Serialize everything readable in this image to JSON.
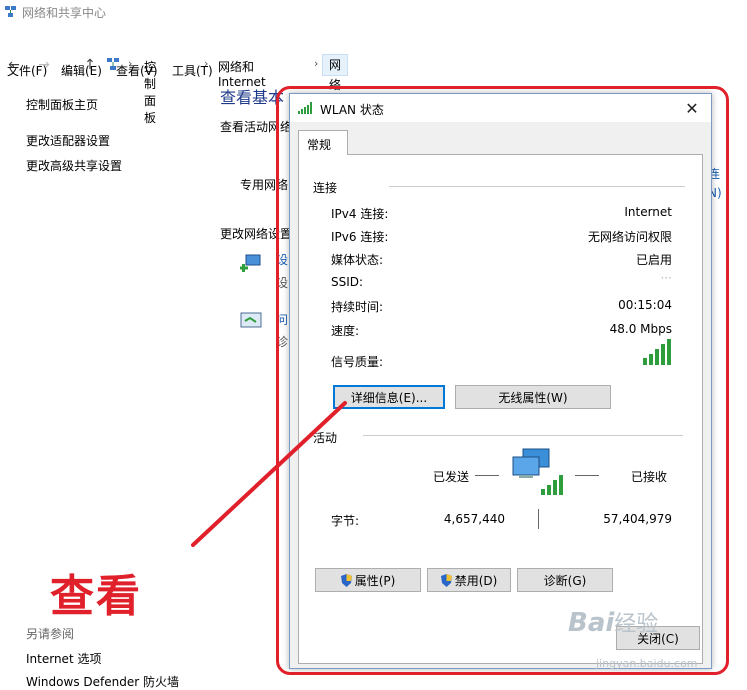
{
  "window": {
    "title": "网络和共享中心"
  },
  "breadcrumb": {
    "items": [
      "控制面板",
      "网络和 Internet",
      "网络和共享中心"
    ]
  },
  "menu": {
    "items": [
      "文件(F)",
      "编辑(E)",
      "查看(V)",
      "工具(T)"
    ]
  },
  "sidebar": {
    "home": "控制面板主页",
    "adapter": "更改适配器设置",
    "advanced": "更改高级共享设置",
    "see_also": "另请参阅",
    "internet_options": "Internet 选项",
    "defender": "Windows Defender 防火墙"
  },
  "main": {
    "heading_partial": "查看基本",
    "active_partial": "查看活动网络",
    "private_partial": "专用网络",
    "change_partial": "更改网络设置",
    "item1_partial": "设",
    "item1_sub": "设",
    "item2_partial": "问",
    "item2_sub": "诊",
    "right_partial1": "连",
    "right_partial2": "N)"
  },
  "dialog": {
    "title": "WLAN 状态",
    "tab": "常规",
    "connection_group": "连接",
    "rows": [
      {
        "label": "IPv4 连接:",
        "value": "Internet"
      },
      {
        "label": "IPv6 连接:",
        "value": "无网络访问权限"
      },
      {
        "label": "媒体状态:",
        "value": "已启用"
      },
      {
        "label": "SSID:",
        "value": "···"
      },
      {
        "label": "持续时间:",
        "value": "00:15:04"
      },
      {
        "label": "速度:",
        "value": "48.0 Mbps"
      },
      {
        "label": "信号质量:",
        "value": ""
      }
    ],
    "details_button": "详细信息(E)...",
    "wireless_button": "无线属性(W)",
    "activity_group": "活动",
    "sent_label": "已发送",
    "received_label": "已接收",
    "bytes_label": "字节:",
    "bytes_sent": "4,657,440",
    "bytes_received": "57,404,979",
    "properties_button": "属性(P)",
    "disable_button": "禁用(D)",
    "diagnose_button": "诊断(G)",
    "close_button": "关闭(C)"
  },
  "annotation": {
    "text": "查看",
    "color": "#e0202a"
  },
  "watermark": {
    "brand": "Bai",
    "brand_tail": "经验",
    "url": "jingyan.baidu.com"
  }
}
